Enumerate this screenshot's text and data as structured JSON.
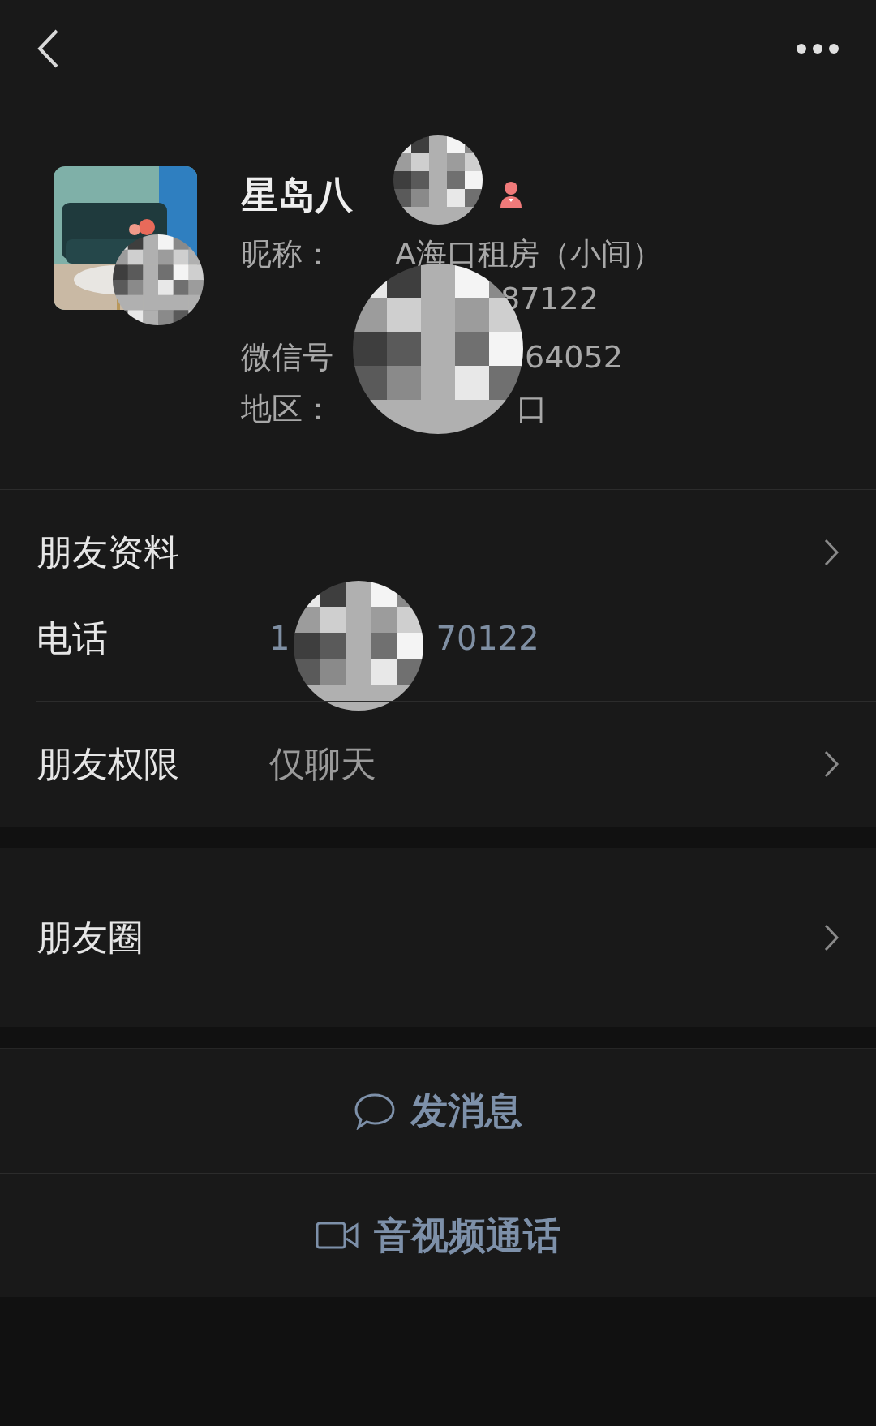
{
  "profile": {
    "name": "星岛八",
    "badge": {
      "kind": "female"
    },
    "nickname_label": "昵称：",
    "nickname": "A海口租房（小间）",
    "nickname_extra": "87122",
    "wechat_id_label": "微信号",
    "wechat_id": "64052",
    "region_label": "地区：",
    "region": "口"
  },
  "sections": [
    {
      "groups": [
        [
          {
            "kind": "link",
            "label": "朋友资料"
          },
          {
            "kind": "phone",
            "label": "电话",
            "prefix": "1",
            "suffix": "70122"
          }
        ],
        [
          {
            "kind": "link",
            "label": "朋友权限",
            "value": "仅聊天"
          }
        ]
      ]
    },
    {
      "groups": [
        [
          {
            "kind": "tall-link",
            "label": "朋友圈"
          }
        ]
      ]
    }
  ],
  "actions": [
    {
      "kind": "chat",
      "label": "发消息"
    },
    {
      "kind": "video",
      "label": "音视频通话"
    }
  ]
}
